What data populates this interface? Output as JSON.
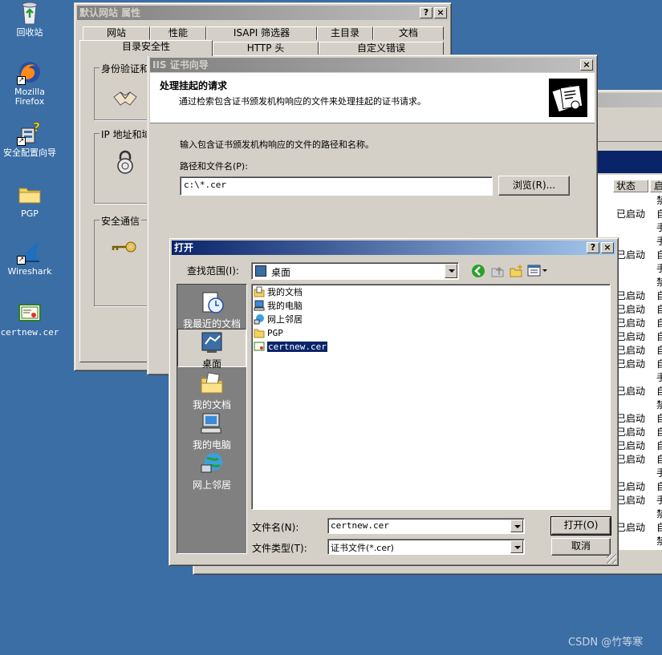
{
  "desktop": {
    "icons": [
      {
        "name": "recycle-bin",
        "label": "回收站"
      },
      {
        "name": "mozilla-firefox",
        "label": "Mozilla\nFirefox"
      },
      {
        "name": "security-config-wizard",
        "label": "安全配置向导"
      },
      {
        "name": "pgp-folder",
        "label": "PGP"
      },
      {
        "name": "wireshark",
        "label": "Wireshark"
      },
      {
        "name": "certnew-cer",
        "label": "certnew.cer"
      }
    ],
    "watermark": "CSDN @竹等寒"
  },
  "props_window": {
    "title": "默认网站 属性",
    "tabs_row1": [
      "网站",
      "性能",
      "ISAPI 筛选器",
      "主目录",
      "文档"
    ],
    "tabs_row2": [
      "目录安全性",
      "HTTP 头",
      "自定义错误"
    ],
    "groups": [
      "身份验证和",
      "IP 地址和域",
      "安全通信"
    ]
  },
  "services": {
    "header_status": "状态",
    "header_start": "启",
    "statuses": [
      "",
      "已启动",
      "",
      "",
      "已启动",
      "",
      "",
      "已启动",
      "已启动",
      "已启动",
      "已启动",
      "已启动",
      "已启动",
      "",
      "已启动",
      "",
      "已启动",
      "已启动",
      "已启动",
      "已启动",
      "",
      "已启动",
      "已启动",
      "",
      "已启动",
      ""
    ],
    "start_types": [
      "禁",
      "自",
      "手",
      "手",
      "自",
      "手",
      "禁",
      "自",
      "自",
      "自",
      "自",
      "自",
      "自",
      "手",
      "自",
      "禁",
      "自",
      "自",
      "自",
      "自",
      "手",
      "自",
      "手",
      "禁",
      "自",
      "禁"
    ]
  },
  "wizard": {
    "title": "IIS 证书向导",
    "heading": "处理挂起的请求",
    "subheading": "通过检索包含证书颁发机构响应的文件来处理挂起的证书请求。",
    "instruction": "输入包含证书颁发机构响应的文件的路径和名称。",
    "path_label": "路径和文件名(P):",
    "path_value": "c:\\*.cer",
    "browse_label": "浏览(R)..."
  },
  "open_dialog": {
    "title": "打开",
    "lookin_label": "查找范围(I):",
    "lookin_value": "桌面",
    "places": [
      "我最近的文档",
      "桌面",
      "我的文档",
      "我的电脑",
      "网上邻居"
    ],
    "files": [
      {
        "icon": "my-documents-icon",
        "label": "我的文档"
      },
      {
        "icon": "my-computer-icon",
        "label": "我的电脑"
      },
      {
        "icon": "network-places-icon",
        "label": "网上邻居"
      },
      {
        "icon": "folder-icon",
        "label": "PGP"
      },
      {
        "icon": "certificate-icon",
        "label": "certnew.cer"
      }
    ],
    "filename_label": "文件名(N):",
    "filename_value": "certnew.cer",
    "filetype_label": "文件类型(T):",
    "filetype_value": "证书文件(*.cer)",
    "open_label": "打开(O)",
    "cancel_label": "取消"
  }
}
